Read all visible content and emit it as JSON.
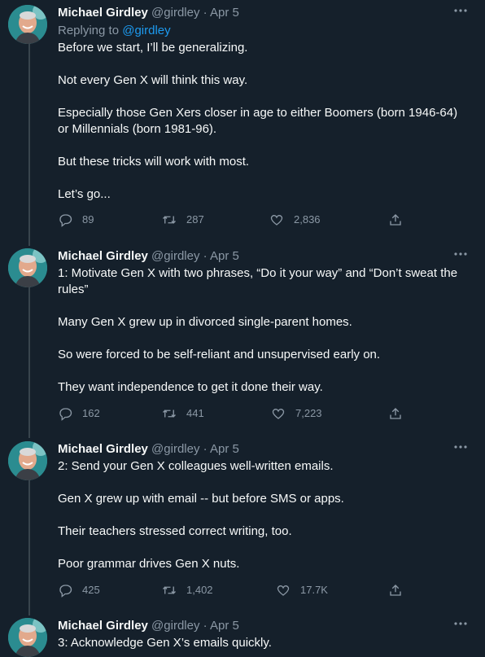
{
  "author": {
    "name": "Michael Girdley",
    "handle": "@girdley",
    "separator": "·"
  },
  "tweets": [
    {
      "date": "Apr 5",
      "replying_prefix": "Replying to",
      "replying_to": "@girdley",
      "paragraphs": [
        "Before we start, I’ll be generalizing.",
        "Not every Gen X will think this way.",
        "Especially those Gen Xers closer in age to either Boomers (born 1946-64) or Millennials (born 1981-96).",
        "But these tricks will work with most.",
        "Let’s go..."
      ],
      "replies": "89",
      "retweets": "287",
      "likes": "2,836"
    },
    {
      "date": "Apr 5",
      "paragraphs": [
        "1: Motivate Gen X with two phrases, “Do it your way” and “Don’t sweat the rules”",
        "Many Gen X grew up in divorced single-parent homes.",
        "So were forced to be self-reliant and unsupervised early on.",
        "They want independence to get it done their way."
      ],
      "replies": "162",
      "retweets": "441",
      "likes": "7,223"
    },
    {
      "date": "Apr 5",
      "paragraphs": [
        "2: Send your Gen X colleagues well-written emails.",
        "Gen X grew up with email -- but before SMS or apps.",
        "Their teachers stressed correct writing, too.",
        "Poor grammar drives Gen X nuts."
      ],
      "replies": "425",
      "retweets": "1,402",
      "likes": "17.7K"
    },
    {
      "date": "Apr 5",
      "paragraphs": [
        "3: Acknowledge Gen X’s emails quickly."
      ]
    }
  ],
  "icons": {
    "reply": "reply-icon",
    "retweet": "retweet-icon",
    "like": "heart-icon",
    "share": "share-icon",
    "more": "more-icon"
  },
  "colors": {
    "background": "#15202b",
    "text": "#f7f9f9",
    "secondary": "#8b98a5",
    "link": "#1d9bf0",
    "thread_line": "#38444d"
  }
}
